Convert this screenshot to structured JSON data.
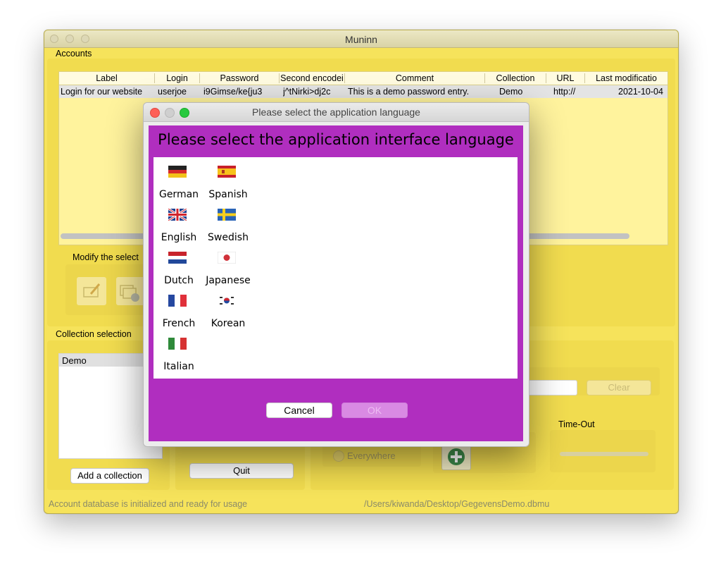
{
  "app": {
    "title": "Muninn"
  },
  "accounts": {
    "section_label": "Accounts",
    "columns": [
      "Label",
      "Login",
      "Password",
      "Second encodei",
      "Comment",
      "Collection",
      "URL",
      "Last modificatio"
    ],
    "rows": [
      [
        "Login for our website",
        "userjoe",
        "i9Gimse/ke{ju3",
        "j^tNirki>dj2c",
        "This is a demo password entry.",
        "Demo",
        "http://",
        "2021-10-04"
      ]
    ]
  },
  "modify": {
    "label": "Modify the select"
  },
  "collection": {
    "section_label": "Collection selection",
    "items": [
      "Demo"
    ],
    "add_button": "Add a collection"
  },
  "controls": {
    "quit_button": "Quit",
    "clear_button": "Clear",
    "everywhere_option": "Everywhere",
    "timeout_label": "Time-Out"
  },
  "status": {
    "left": "Account database is initialized and ready for usage",
    "right": "/Users/kiwanda/Desktop/GegevensDemo.dbmu"
  },
  "dialog": {
    "window_title": "Please select the application language",
    "heading": "Please select the application interface language",
    "languages": [
      {
        "label": "German",
        "icon": "flag-de-icon"
      },
      {
        "label": "Spanish",
        "icon": "flag-es-icon"
      },
      {
        "label": "English",
        "icon": "flag-gb-icon"
      },
      {
        "label": "Swedish",
        "icon": "flag-se-icon"
      },
      {
        "label": "Dutch",
        "icon": "flag-nl-icon"
      },
      {
        "label": "Japanese",
        "icon": "flag-jp-icon"
      },
      {
        "label": "French",
        "icon": "flag-fr-icon"
      },
      {
        "label": "Korean",
        "icon": "flag-kr-icon"
      },
      {
        "label": "Italian",
        "icon": "flag-it-icon"
      }
    ],
    "cancel_button": "Cancel",
    "ok_button": "OK"
  },
  "colors": {
    "window_bg": "#f6e35b",
    "dialog_accent": "#b02ebf",
    "table_bg": "#fff39d"
  }
}
